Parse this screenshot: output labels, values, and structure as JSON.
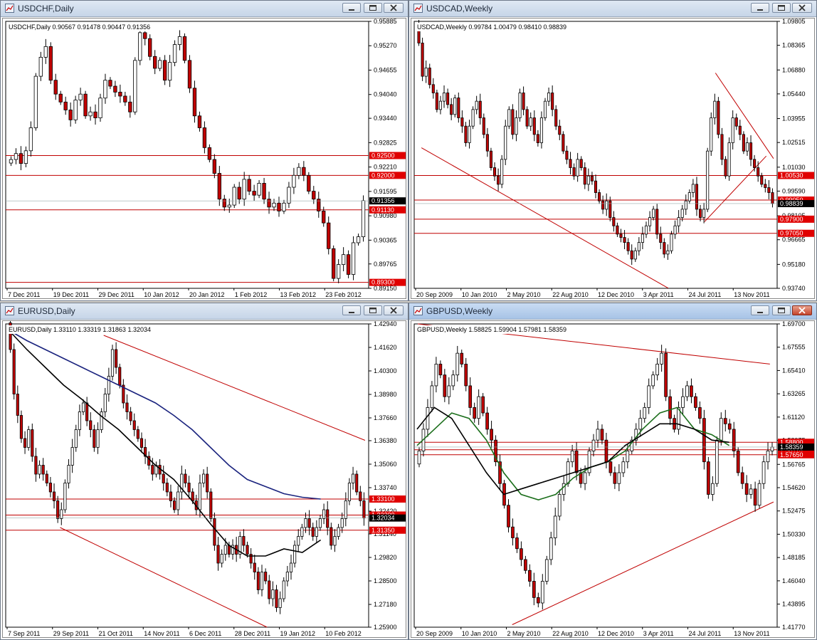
{
  "windows": [
    {
      "title": "USDCHF,Daily",
      "active": false
    },
    {
      "title": "USDCAD,Weekly",
      "active": false
    },
    {
      "title": "EURUSD,Daily",
      "active": false
    },
    {
      "title": "GBPUSD,Weekly",
      "active": true
    }
  ],
  "chart_data": [
    {
      "type": "candlestick",
      "symbol": "USDCHF,Daily",
      "ohlc_label": "USDCHF,Daily  0.90567 0.91478 0.90447 0.91356",
      "ylim": [
        0.8915,
        0.95885
      ],
      "y_ticks": [
        "0.95885",
        "0.95270",
        "0.94655",
        "0.94040",
        "0.93440",
        "0.92825",
        "0.92210",
        "0.91595",
        "0.90980",
        "0.90365",
        "0.89765",
        "0.89150"
      ],
      "x_ticks": [
        "7 Dec 2011",
        "19 Dec 2011",
        "29 Dec 2011",
        "10 Jan 2012",
        "20 Jan 2012",
        "1 Feb 2012",
        "13 Feb 2012",
        "23 Feb 2012"
      ],
      "hlines": [
        {
          "value": 0.925,
          "label": "0.92500"
        },
        {
          "value": 0.92,
          "label": "0.92000"
        },
        {
          "value": 0.9113,
          "label": "0.91130"
        },
        {
          "value": 0.893,
          "label": "0.89300"
        }
      ],
      "current": {
        "value": 0.91356,
        "label": "0.91356"
      },
      "trendlines": [],
      "closes": [
        0.924,
        0.9255,
        0.923,
        0.9262,
        0.932,
        0.945,
        0.9498,
        0.9525,
        0.944,
        0.9405,
        0.9385,
        0.9365,
        0.934,
        0.939,
        0.9405,
        0.935,
        0.936,
        0.9345,
        0.9395,
        0.944,
        0.9425,
        0.941,
        0.94,
        0.9385,
        0.936,
        0.949,
        0.956,
        0.9545,
        0.95,
        0.947,
        0.949,
        0.944,
        0.9485,
        0.953,
        0.955,
        0.949,
        0.942,
        0.935,
        0.932,
        0.927,
        0.924,
        0.9205,
        0.914,
        0.912,
        0.9125,
        0.917,
        0.914,
        0.919,
        0.916,
        0.915,
        0.918,
        0.914,
        0.912,
        0.913,
        0.911,
        0.913,
        0.917,
        0.92,
        0.922,
        0.92,
        0.916,
        0.914,
        0.911,
        0.908,
        0.9015,
        0.894,
        0.8975,
        0.9,
        0.895,
        0.903,
        0.9045,
        0.9136
      ]
    },
    {
      "type": "candlestick",
      "symbol": "USDCAD,Weekly",
      "ohlc_label": "USDCAD,Weekly  0.99784 1.00479 0.98410 0.98839",
      "ylim": [
        0.9374,
        1.09805
      ],
      "y_ticks": [
        "1.09805",
        "1.08365",
        "1.06880",
        "1.05440",
        "1.03955",
        "1.02515",
        "1.01030",
        "0.99590",
        "0.98105",
        "0.96665",
        "0.95180",
        "0.93740"
      ],
      "x_ticks": [
        "20 Sep 2009",
        "10 Jan 2010",
        "2 May 2010",
        "22 Aug 2010",
        "12 Dec 2010",
        "3 Apr 2011",
        "24 Jul 2011",
        "13 Nov 2011"
      ],
      "hlines": [
        {
          "value": 1.0053,
          "label": "1.00530"
        },
        {
          "value": 0.9905,
          "label": "0.99050"
        },
        {
          "value": 0.979,
          "label": "0.97900"
        },
        {
          "value": 0.9705,
          "label": "0.97050"
        }
      ],
      "current": {
        "value": 0.98839,
        "label": "0.98839"
      },
      "trendlines": [
        {
          "x1": 0.02,
          "y1": 1.022,
          "x2": 0.7,
          "y2": 0.9375
        },
        {
          "x1": 0.8,
          "y1": 0.9775,
          "x2": 0.97,
          "y2": 1.017
        },
        {
          "x1": 0.83,
          "y1": 1.067,
          "x2": 0.99,
          "y2": 1.0155
        }
      ],
      "closes": [
        1.085,
        1.065,
        1.07,
        1.06,
        1.055,
        1.045,
        1.05,
        1.055,
        1.048,
        1.042,
        1.052,
        1.04,
        1.035,
        1.025,
        1.035,
        1.045,
        1.05,
        1.04,
        1.03,
        1.02,
        1.01,
        1.005,
        1.0,
        1.015,
        1.035,
        1.045,
        1.03,
        1.04,
        1.055,
        1.045,
        1.035,
        1.04,
        1.03,
        1.025,
        1.04,
        1.05,
        1.055,
        1.045,
        1.035,
        1.03,
        1.02,
        1.015,
        1.01,
        1.005,
        1.015,
        1.01,
        1.0,
        1.005,
        1.002,
        0.995,
        0.99,
        0.985,
        0.99,
        0.98,
        0.975,
        0.97,
        0.968,
        0.965,
        0.96,
        0.955,
        0.96,
        0.965,
        0.97,
        0.975,
        0.98,
        0.985,
        0.97,
        0.965,
        0.958,
        0.96,
        0.97,
        0.975,
        0.98,
        0.985,
        0.99,
        0.995,
        1.0,
        0.985,
        0.98,
        0.985,
        1.02,
        1.04,
        1.05,
        1.03,
        1.015,
        1.005,
        1.025,
        1.04,
        1.035,
        1.03,
        1.02,
        1.025,
        1.015,
        1.01,
        1.005,
        1.0,
        0.998,
        0.995,
        0.9884
      ]
    },
    {
      "type": "candlestick",
      "symbol": "EURUSD,Daily",
      "ohlc_label": "EURUSD,Daily  1.33110 1.33319 1.31863 1.32034",
      "ylim": [
        1.259,
        1.4294
      ],
      "y_ticks": [
        "1.42940",
        "1.41620",
        "1.40300",
        "1.38980",
        "1.37660",
        "1.36380",
        "1.35060",
        "1.33740",
        "1.32420",
        "1.31140",
        "1.29820",
        "1.28500",
        "1.27180",
        "1.25900"
      ],
      "x_ticks": [
        "7 Sep 2011",
        "29 Sep 2011",
        "21 Oct 2011",
        "14 Nov 2011",
        "6 Dec 2011",
        "28 Dec 2011",
        "19 Jan 2012",
        "10 Feb 2012"
      ],
      "hlines": [
        {
          "value": 1.331,
          "label": "1.33100"
        },
        {
          "value": 1.322,
          "label": "1.32200"
        },
        {
          "value": 1.3135,
          "label": "1.31350"
        }
      ],
      "current": {
        "value": 1.32034,
        "label": "1.32034"
      },
      "trendlines": [
        {
          "x1": 0.27,
          "y1": 1.423,
          "x2": 0.99,
          "y2": 1.364
        },
        {
          "x1": 0.15,
          "y1": 1.315,
          "x2": 0.72,
          "y2": 1.259
        }
      ],
      "ma_blue": [
        1.426,
        1.42,
        1.415,
        1.41,
        1.405,
        1.4,
        1.395,
        1.39,
        1.385,
        1.378,
        1.37,
        1.36,
        1.35,
        1.342,
        1.338,
        1.334,
        1.332,
        1.331
      ],
      "ma_black": [
        1.426,
        1.415,
        1.405,
        1.395,
        1.387,
        1.378,
        1.37,
        1.36,
        1.35,
        1.342,
        1.33,
        1.317,
        1.305,
        1.299,
        1.299,
        1.303,
        1.301,
        1.308
      ],
      "closes": [
        1.415,
        1.39,
        1.378,
        1.365,
        1.36,
        1.37,
        1.355,
        1.345,
        1.35,
        1.345,
        1.34,
        1.335,
        1.33,
        1.32,
        1.325,
        1.34,
        1.35,
        1.36,
        1.37,
        1.38,
        1.385,
        1.375,
        1.37,
        1.36,
        1.37,
        1.38,
        1.39,
        1.4,
        1.415,
        1.405,
        1.395,
        1.385,
        1.38,
        1.375,
        1.37,
        1.365,
        1.36,
        1.355,
        1.35,
        1.345,
        1.35,
        1.345,
        1.34,
        1.335,
        1.33,
        1.325,
        1.335,
        1.345,
        1.34,
        1.335,
        1.33,
        1.325,
        1.34,
        1.345,
        1.335,
        1.32,
        1.305,
        1.295,
        1.3,
        1.305,
        1.3,
        1.305,
        1.3,
        1.31,
        1.305,
        1.3,
        1.295,
        1.29,
        1.28,
        1.29,
        1.285,
        1.275,
        1.28,
        1.27,
        1.275,
        1.285,
        1.29,
        1.295,
        1.305,
        1.31,
        1.315,
        1.32,
        1.315,
        1.31,
        1.315,
        1.32,
        1.325,
        1.315,
        1.305,
        1.31,
        1.315,
        1.32,
        1.33,
        1.34,
        1.345,
        1.335,
        1.33,
        1.3203
      ]
    },
    {
      "type": "candlestick",
      "symbol": "GBPUSD,Weekly",
      "ohlc_label": "GBPUSD,Weekly  1.58825 1.59904 1.57981 1.58359",
      "ylim": [
        1.4177,
        1.697
      ],
      "y_ticks": [
        "1.69700",
        "1.67555",
        "1.65410",
        "1.63265",
        "1.61120",
        "1.58975",
        "1.56765",
        "1.54620",
        "1.52475",
        "1.50330",
        "1.48185",
        "1.46040",
        "1.43895",
        "1.41770"
      ],
      "x_ticks": [
        "20 Sep 2009",
        "10 Jan 2010",
        "2 May 2010",
        "22 Aug 2010",
        "12 Dec 2010",
        "3 Apr 2011",
        "24 Jul 2011",
        "13 Nov 2011"
      ],
      "hlines": [
        {
          "value": 1.588,
          "label": "1.58800"
        },
        {
          "value": 1.5811,
          "label": "1.58110"
        },
        {
          "value": 1.5765,
          "label": "1.57650"
        }
      ],
      "current": {
        "value": 1.58359,
        "label": "1.58359"
      },
      "trendlines": [
        {
          "x1": 0.01,
          "y1": 1.697,
          "x2": 0.98,
          "y2": 1.66
        },
        {
          "x1": 0.27,
          "y1": 1.42,
          "x2": 0.99,
          "y2": 1.533
        }
      ],
      "ma_green": [
        1.585,
        1.6,
        1.615,
        1.61,
        1.59,
        1.56,
        1.54,
        1.535,
        1.54,
        1.555,
        1.565,
        1.57,
        1.58,
        1.6,
        1.615,
        1.62,
        1.6,
        1.595,
        1.585
      ],
      "ma_black": [
        1.6,
        1.62,
        1.61,
        1.585,
        1.56,
        1.54,
        1.545,
        1.55,
        1.555,
        1.56,
        1.565,
        1.57,
        1.585,
        1.595,
        1.605,
        1.605,
        1.6,
        1.59,
        1.588
      ],
      "closes": [
        1.58,
        1.6,
        1.62,
        1.64,
        1.66,
        1.65,
        1.63,
        1.64,
        1.65,
        1.67,
        1.66,
        1.64,
        1.62,
        1.61,
        1.63,
        1.615,
        1.6,
        1.59,
        1.57,
        1.55,
        1.53,
        1.51,
        1.5,
        1.49,
        1.48,
        1.47,
        1.46,
        1.445,
        1.44,
        1.46,
        1.48,
        1.5,
        1.52,
        1.54,
        1.55,
        1.57,
        1.58,
        1.56,
        1.55,
        1.56,
        1.58,
        1.59,
        1.6,
        1.59,
        1.57,
        1.56,
        1.55,
        1.56,
        1.57,
        1.58,
        1.59,
        1.6,
        1.61,
        1.62,
        1.64,
        1.65,
        1.66,
        1.67,
        1.63,
        1.61,
        1.6,
        1.62,
        1.63,
        1.64,
        1.63,
        1.62,
        1.61,
        1.57,
        1.54,
        1.55,
        1.59,
        1.61,
        1.605,
        1.6,
        1.58,
        1.56,
        1.55,
        1.54,
        1.545,
        1.53,
        1.55,
        1.57,
        1.58,
        1.5836
      ]
    }
  ]
}
